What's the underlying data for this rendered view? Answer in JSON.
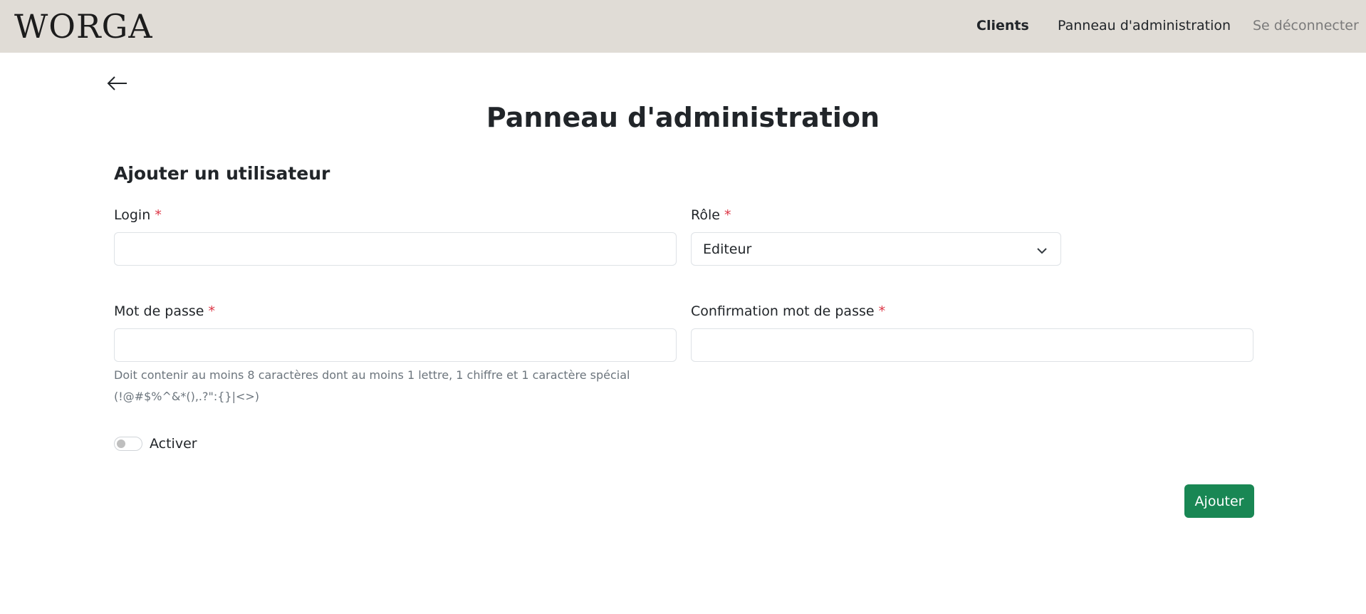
{
  "navbar": {
    "brand": "WORGA",
    "links": [
      {
        "label": "Clients"
      },
      {
        "label": "Panneau d'administration"
      },
      {
        "label": "Se déconnecter"
      }
    ]
  },
  "page": {
    "title": "Panneau d'administration",
    "section_title": "Ajouter un utilisateur"
  },
  "form": {
    "required_mark": "*",
    "login": {
      "label": "Login",
      "value": ""
    },
    "role": {
      "label": "Rôle",
      "selected": "Editeur"
    },
    "password": {
      "label": "Mot de passe",
      "value": "",
      "help": "Doit contenir au moins 8 caractères dont au moins 1 lettre, 1 chiffre et 1 caractère spécial (!@#$%^&*(),.?\":{}|<>)"
    },
    "password_confirm": {
      "label": "Confirmation mot de passe",
      "value": ""
    },
    "activate": {
      "label": "Activer",
      "checked": false
    },
    "submit_label": "Ajouter"
  },
  "icons": {
    "back": "arrow-left-icon",
    "select": "chevron-down-icon"
  },
  "colors": {
    "navbar_bg": "#e0dcd6",
    "primary_button": "#198754",
    "required": "#dc3545",
    "muted_text": "#6c757d"
  }
}
